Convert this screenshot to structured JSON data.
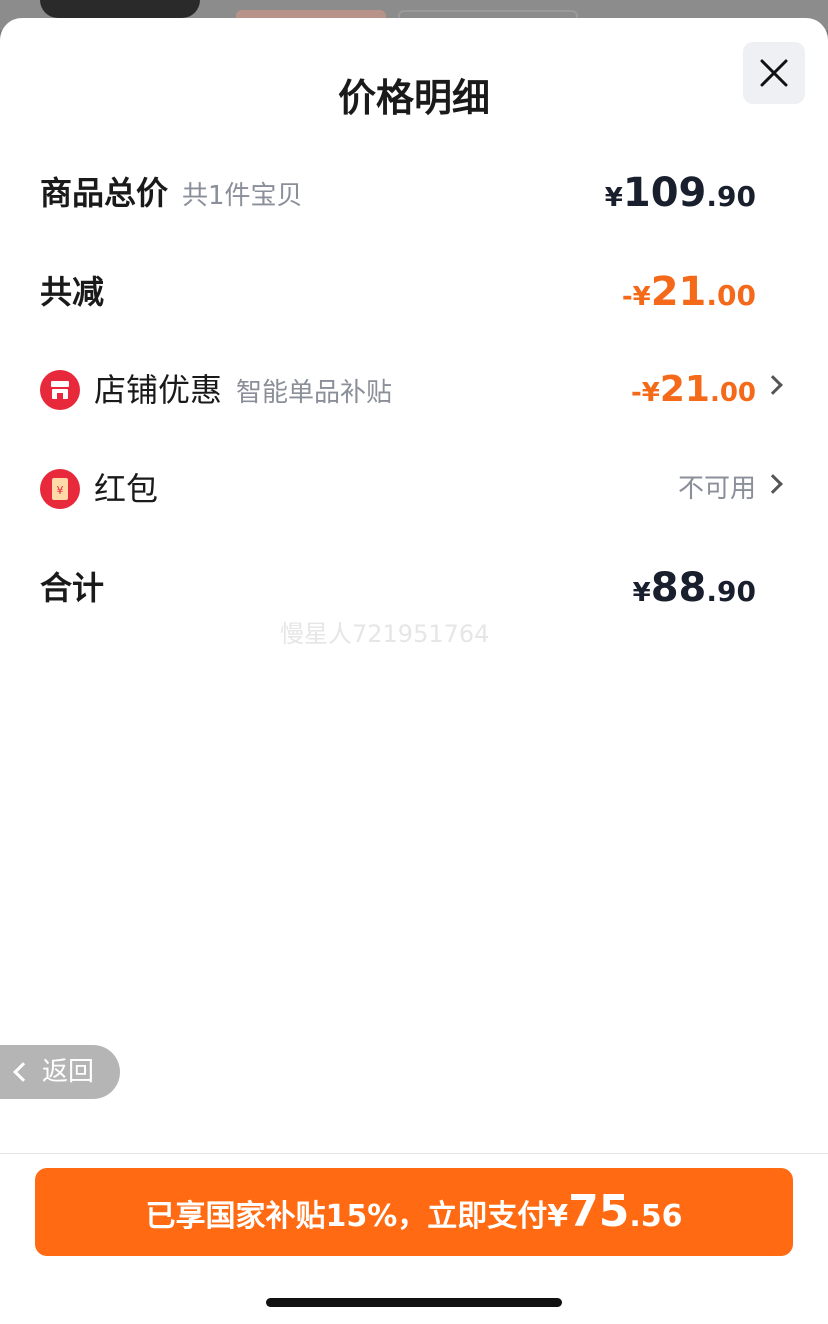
{
  "header": {
    "title": "价格明细"
  },
  "rows": {
    "total": {
      "label": "商品总价",
      "sub": "共1件宝贝",
      "currency": "¥",
      "int": "109",
      "dec": ".90"
    },
    "reduce": {
      "label": "共减",
      "currency": "-¥",
      "int": "21",
      "dec": ".00"
    },
    "shop": {
      "label": "店铺优惠",
      "sub": "智能单品补贴",
      "currency": "-¥",
      "int": "21",
      "dec": ".00"
    },
    "redpacket": {
      "label": "红包",
      "status": "不可用"
    },
    "sum": {
      "label": "合计",
      "currency": "¥",
      "int": "88",
      "dec": ".90"
    }
  },
  "watermark": "慢星人721951764",
  "back": {
    "label": "返回"
  },
  "pay": {
    "text": "已享国家补贴15%，立即支付",
    "currency": "¥",
    "int": "75",
    "dec": ".56"
  },
  "colors": {
    "accent": "#ff6a12",
    "discount": "#f46a1a",
    "icon_red": "#e8283b"
  },
  "icons": [
    "close-icon",
    "shop-icon",
    "red-packet-icon",
    "chevron-right-icon",
    "back-arrow-icon"
  ]
}
